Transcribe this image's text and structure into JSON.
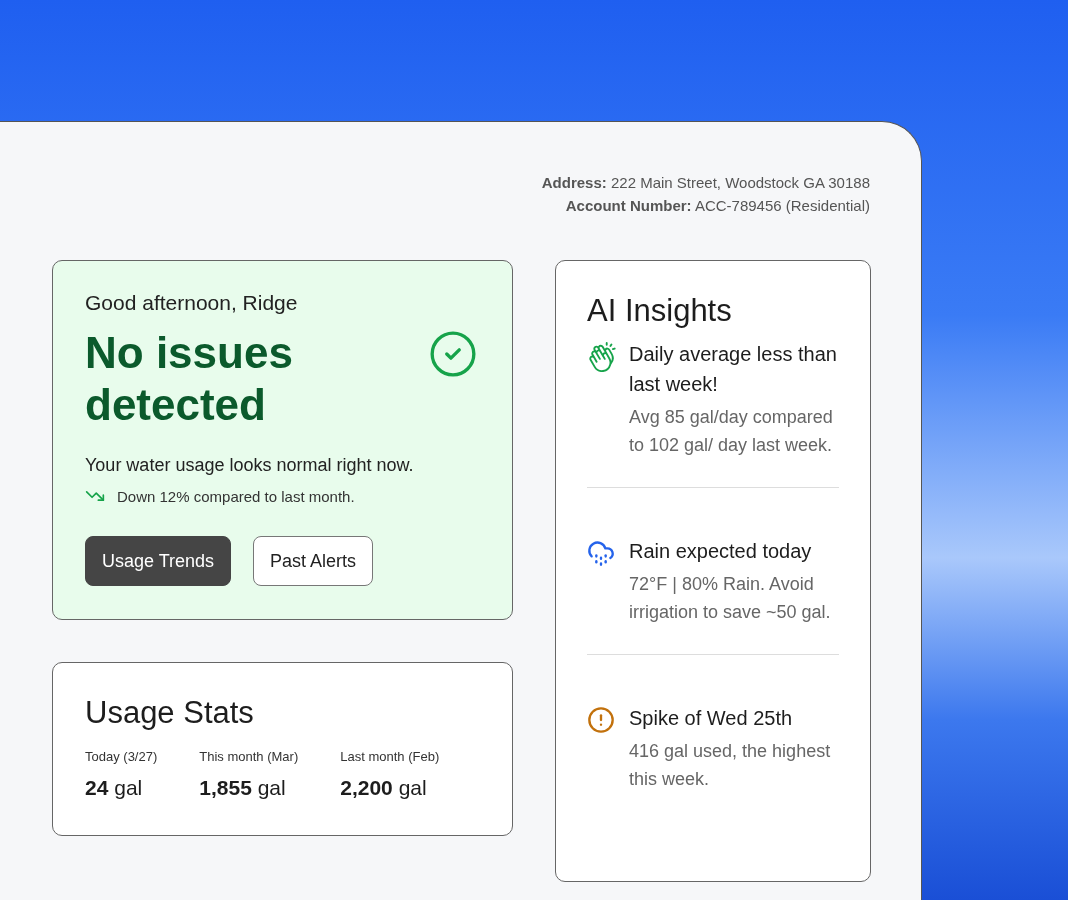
{
  "account": {
    "address": "**Address:** 222 Main Street, Woodstock GA 30188",
    "account_number": "**Account Number:** ACC-789456 (Residential)"
  },
  "status": {
    "greeting": "Good afternoon, Ridge",
    "headline": "No issues detected",
    "ok": true,
    "message": "Your water usage looks normal right now.",
    "trend": "Down 12% compared to last month.",
    "buttons": [
      {
        "label": "Usage Trends",
        "selected": true
      },
      {
        "label": "Past Alerts",
        "selected": false
      }
    ]
  },
  "usage_stats": {
    "title": "Usage Stats",
    "stats": [
      {
        "label": "Today (3/27)",
        "value": "24",
        "unit": "gal"
      },
      {
        "label": "This month (Mar)",
        "value": "1,855",
        "unit": "gal"
      },
      {
        "label": "Last month (Feb)",
        "value": "2,200",
        "unit": "gal"
      }
    ]
  },
  "insights": {
    "title": "AI Insights",
    "items": [
      {
        "kind": "praise",
        "color": "#16a34a",
        "title": "Daily average less than last week!",
        "body": "Avg 85 gal/day compared to 102 gal/ day last week."
      },
      {
        "kind": "weather",
        "color": "#2563eb",
        "title": "Rain expected today",
        "body": "72°F | 80% Rain. Avoid irrigation to save ~50 gal."
      },
      {
        "kind": "alert",
        "color": "#c2710c",
        "title": "Spike of Wed 25th",
        "body": "416 gal used, the highest this week."
      }
    ]
  }
}
